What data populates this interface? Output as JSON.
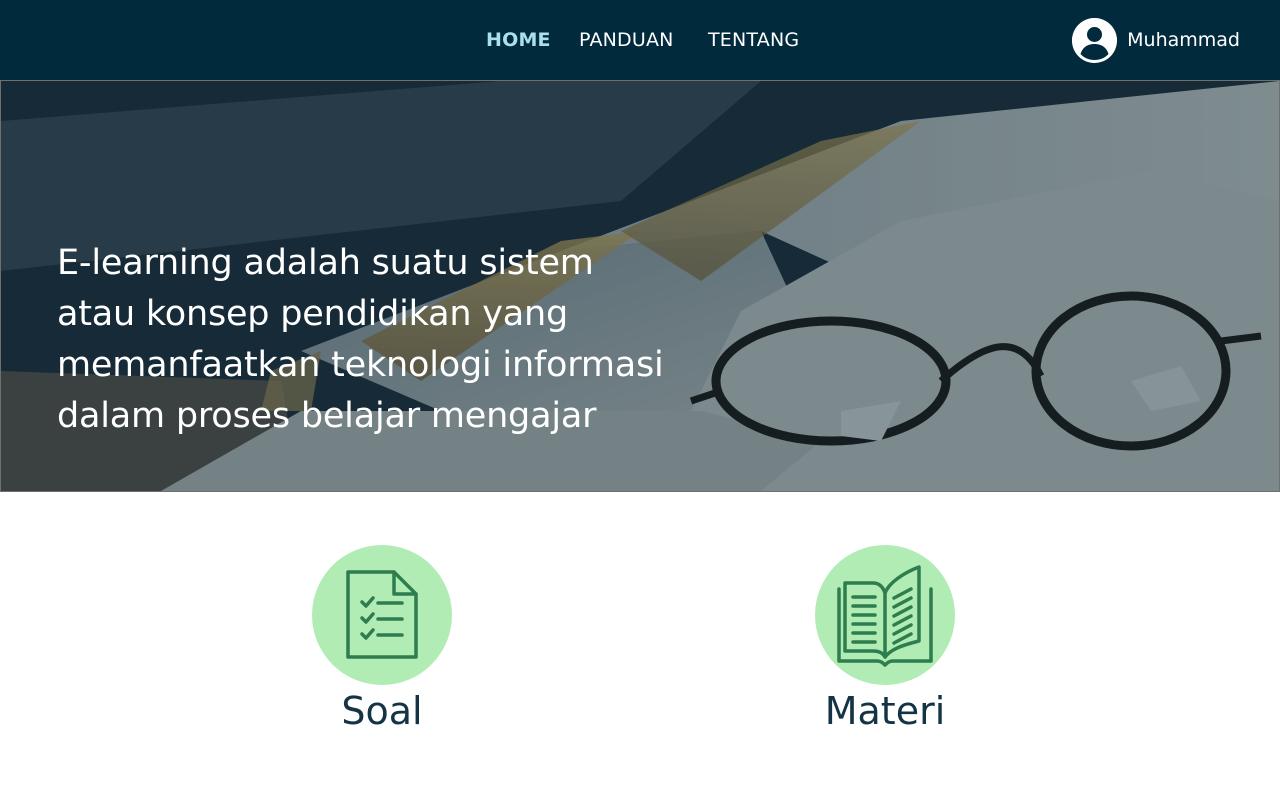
{
  "nav": {
    "items": [
      {
        "label": "HOME",
        "active": true
      },
      {
        "label": "PANDUAN",
        "active": false
      },
      {
        "label": "TENTANG",
        "active": false
      }
    ]
  },
  "user": {
    "name": "Muhammad",
    "icon": "user-circle-icon"
  },
  "hero": {
    "lines": [
      "E-learning adalah suatu sistem",
      "atau konsep pendidikan yang",
      "memanfaatkan teknologi informasi",
      "dalam proses belajar mengajar"
    ]
  },
  "cards": [
    {
      "label": "Soal",
      "icon": "checklist-document-icon"
    },
    {
      "label": "Materi",
      "icon": "open-book-icon"
    }
  ],
  "colors": {
    "navbar": "#012a3c",
    "nav_active": "#a9e0ec",
    "card_circle": "#b1ecb5",
    "icon_stroke": "#2e7d4f",
    "card_label": "#143445"
  }
}
